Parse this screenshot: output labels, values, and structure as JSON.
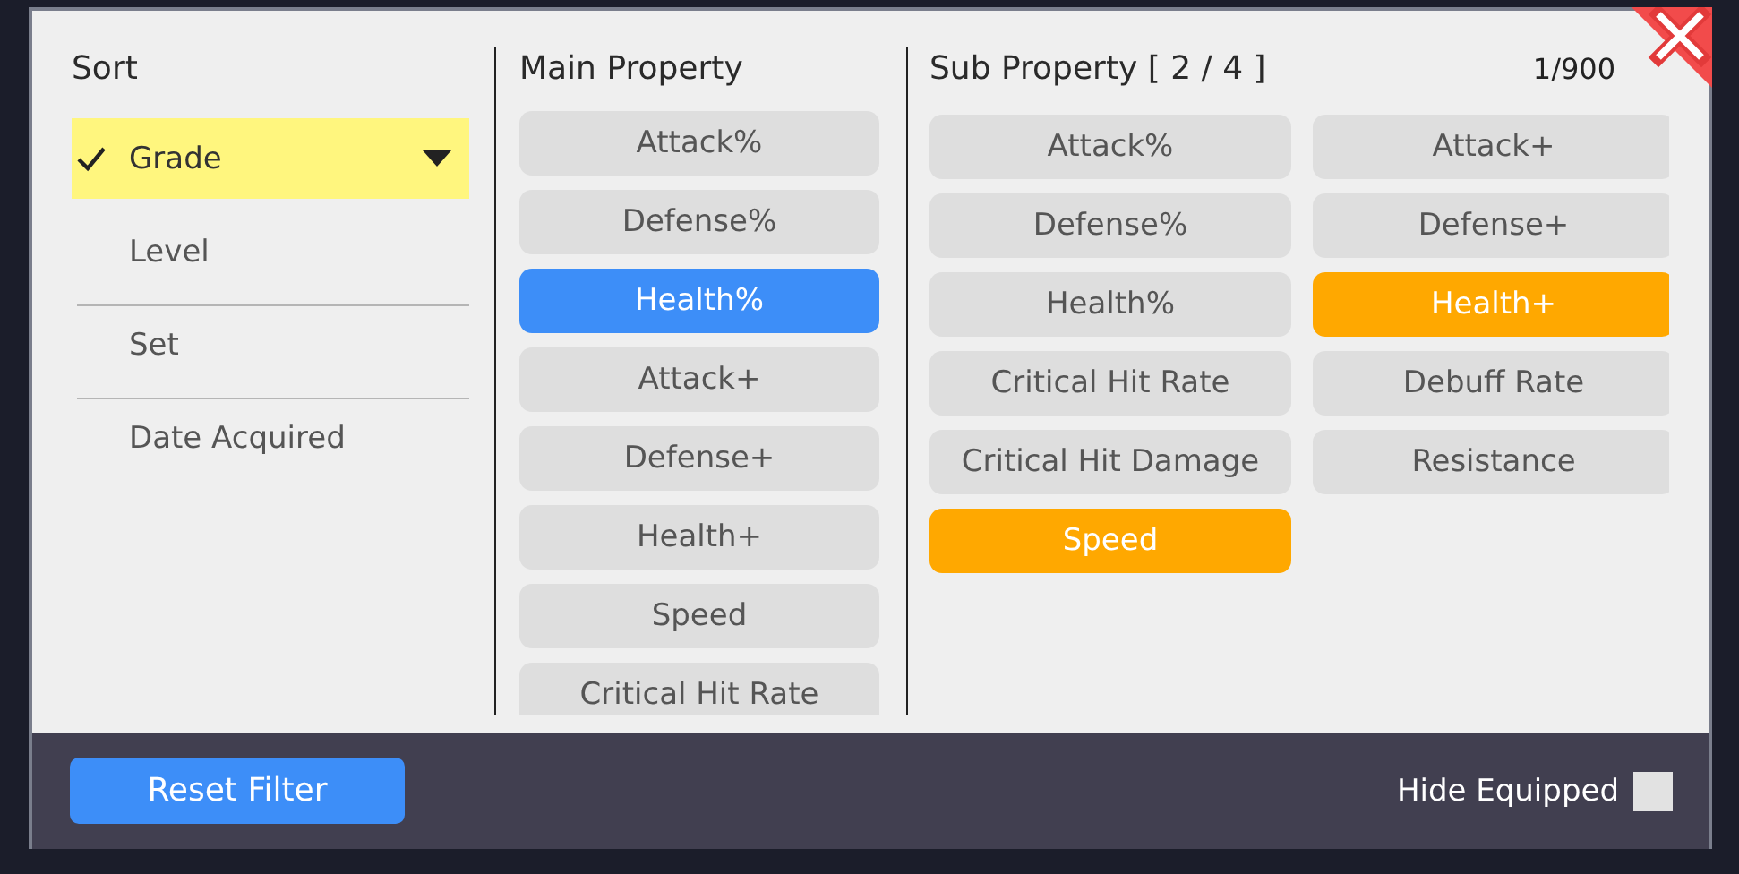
{
  "sort": {
    "title": "Sort",
    "items": [
      {
        "label": "Grade",
        "selected": true
      },
      {
        "label": "Level",
        "selected": false
      },
      {
        "label": "Set",
        "selected": false
      },
      {
        "label": "Date Acquired",
        "selected": false
      }
    ]
  },
  "main_property": {
    "title": "Main Property",
    "options": [
      {
        "label": "Attack%",
        "selected": false
      },
      {
        "label": "Defense%",
        "selected": false
      },
      {
        "label": "Health%",
        "selected": true
      },
      {
        "label": "Attack+",
        "selected": false
      },
      {
        "label": "Defense+",
        "selected": false
      },
      {
        "label": "Health+",
        "selected": false
      },
      {
        "label": "Speed",
        "selected": false
      },
      {
        "label": "Critical Hit Rate",
        "selected": false
      }
    ]
  },
  "sub_property": {
    "title": "Sub Property [ 2 / 4 ]",
    "count": "1/900",
    "columns": [
      [
        {
          "label": "Attack%",
          "selected": false
        },
        {
          "label": "Defense%",
          "selected": false
        },
        {
          "label": "Health%",
          "selected": false
        },
        {
          "label": "Critical Hit Rate",
          "selected": false
        },
        {
          "label": "Critical Hit Damage",
          "selected": false
        },
        {
          "label": "Speed",
          "selected": true
        }
      ],
      [
        {
          "label": "Attack+",
          "selected": false
        },
        {
          "label": "Defense+",
          "selected": false
        },
        {
          "label": "Health+",
          "selected": true
        },
        {
          "label": "Debuff Rate",
          "selected": false
        },
        {
          "label": "Resistance",
          "selected": false
        }
      ]
    ]
  },
  "footer": {
    "reset_button": "Reset Filter",
    "hide_equipped": {
      "label": "Hide Equipped",
      "checked": false
    }
  }
}
